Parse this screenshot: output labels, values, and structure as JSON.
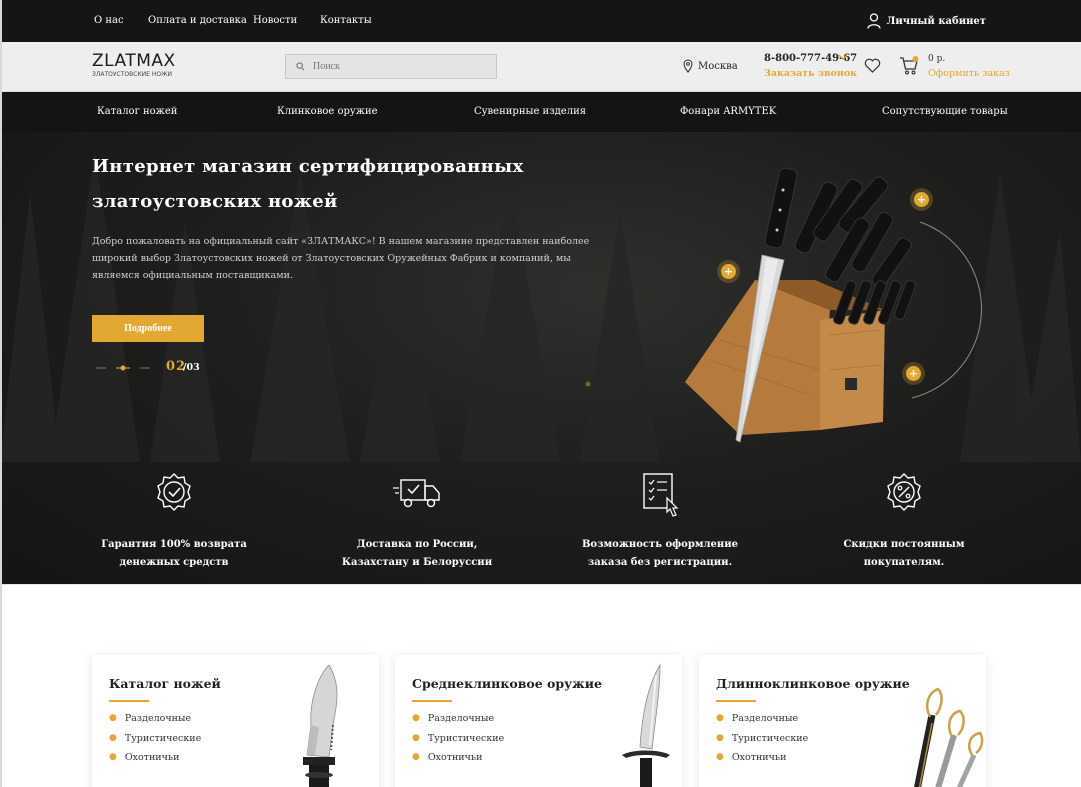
{
  "topbar": {
    "links": [
      "О нас",
      "Оплата и доставка",
      "Новости",
      "Контакты"
    ],
    "account_label": "Личный кабинет"
  },
  "header": {
    "logo_title": "ZLATMAX",
    "logo_sub": "ЗЛАТОУСТОВСКИЕ НОЖИ",
    "search_placeholder": "Поиск",
    "city": "Москва",
    "phone": "8-800-777-49-67",
    "callback": "Заказать звонок",
    "cart_price": "0 р.",
    "cart_order": "Оформить заказ"
  },
  "nav": {
    "items": [
      "Каталог ножей",
      "Клинковое оружие",
      "Сувенирные изделия",
      "Фонари ARMYTEK",
      "Сопутствующие товары"
    ]
  },
  "hero": {
    "title_line1": "Интернет магазин сертифицированных",
    "title_line2": "златоустовских ножей",
    "description": "Добро пожаловать на официальный сайт «ЗЛАТМАКС»! В нашем магазине представлен наиболее широкий выбор Златоустовских ножей от Златоустовских Оружейных Фабрик и компаний, мы являемся официальным поставщиками.",
    "button": "Подробнее",
    "slide_current": "02",
    "slide_total": "/03"
  },
  "features": [
    {
      "icon": "check-badge-icon",
      "line1": "Гарантия 100% возврата",
      "line2": "денежных средств"
    },
    {
      "icon": "delivery-truck-icon",
      "line1": "Доставка по России,",
      "line2": "Казахстану и Белоруссии"
    },
    {
      "icon": "order-form-icon",
      "line1": "Возможность оформление",
      "line2": "заказа без регистрации."
    },
    {
      "icon": "discount-badge-icon",
      "line1": "Скидки постоянным",
      "line2": "покупателям."
    }
  ],
  "cards": [
    {
      "title": "Каталог ножей",
      "items": [
        "Разделочные",
        "Туристические",
        "Охотничьи"
      ]
    },
    {
      "title": "Среднеклинковое оружие",
      "items": [
        "Разделочные",
        "Туристические",
        "Охотничьи"
      ]
    },
    {
      "title": "Длинноклинковое оружие",
      "items": [
        "Разделочные",
        "Туристические",
        "Охотничьи"
      ]
    }
  ],
  "colors": {
    "accent": "#e3a832",
    "dark": "#151515"
  }
}
